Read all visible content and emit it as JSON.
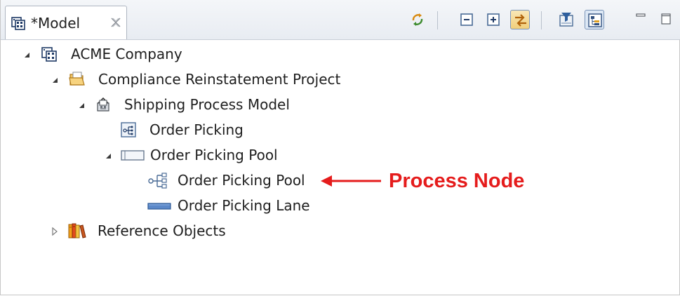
{
  "window": {
    "tab": {
      "title": "*Model",
      "icon": "model-icon",
      "close_icon": "close-icon"
    }
  },
  "toolbar": {
    "buttons": [
      {
        "icon": "sync-icon",
        "state": "normal"
      },
      {
        "icon": "collapse-all-icon",
        "state": "normal"
      },
      {
        "icon": "expand-all-icon",
        "state": "normal"
      },
      {
        "icon": "link-with-editor-icon",
        "state": "pressed"
      },
      {
        "icon": "filter-icon",
        "state": "normal"
      },
      {
        "icon": "tree-layout-icon",
        "state": "pressed"
      },
      {
        "icon": "minimize-icon",
        "state": "normal"
      },
      {
        "icon": "maximize-icon",
        "state": "normal"
      }
    ]
  },
  "tree": {
    "nodes": [
      {
        "label": "ACME Company",
        "icon": "company-icon",
        "expanded": true
      },
      {
        "label": "Compliance Reinstatement Project",
        "icon": "project-folder-icon",
        "expanded": true
      },
      {
        "label": "Shipping Process Model",
        "icon": "process-model-icon",
        "expanded": true
      },
      {
        "label": "Order Picking",
        "icon": "diagram-icon"
      },
      {
        "label": "Order Picking Pool",
        "icon": "pool-icon",
        "expanded": true
      },
      {
        "label": "Order Picking Pool",
        "icon": "process-node-icon"
      },
      {
        "label": "Order Picking Lane",
        "icon": "lane-icon"
      },
      {
        "label": "Reference Objects",
        "icon": "books-icon",
        "expanded": false
      }
    ]
  },
  "annotation": {
    "label": "Process Node",
    "color": "#e51c1c"
  },
  "colors": {
    "tab_border": "#aeb6c1",
    "tab_bar": "#e8ecf2",
    "text": "#1e1e1e"
  }
}
